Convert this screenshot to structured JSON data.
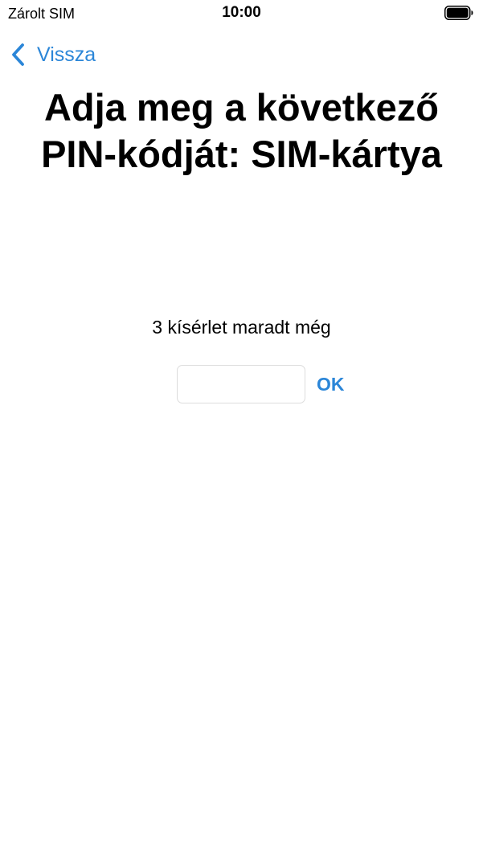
{
  "status_bar": {
    "carrier": "Zárolt SIM",
    "time": "10:00",
    "battery_icon": "battery-full-icon"
  },
  "nav": {
    "back_label": "Vissza",
    "back_icon": "chevron-left-icon"
  },
  "title": "Adja meg a következő PIN-kódját: SIM-kártya",
  "attempts_text": "3 kísérlet maradt még",
  "pin_input": {
    "value": "",
    "placeholder": ""
  },
  "ok_label": "OK",
  "colors": {
    "accent": "#2b86d8",
    "text": "#000000",
    "background": "#ffffff",
    "input_border": "#dcdcdc"
  }
}
